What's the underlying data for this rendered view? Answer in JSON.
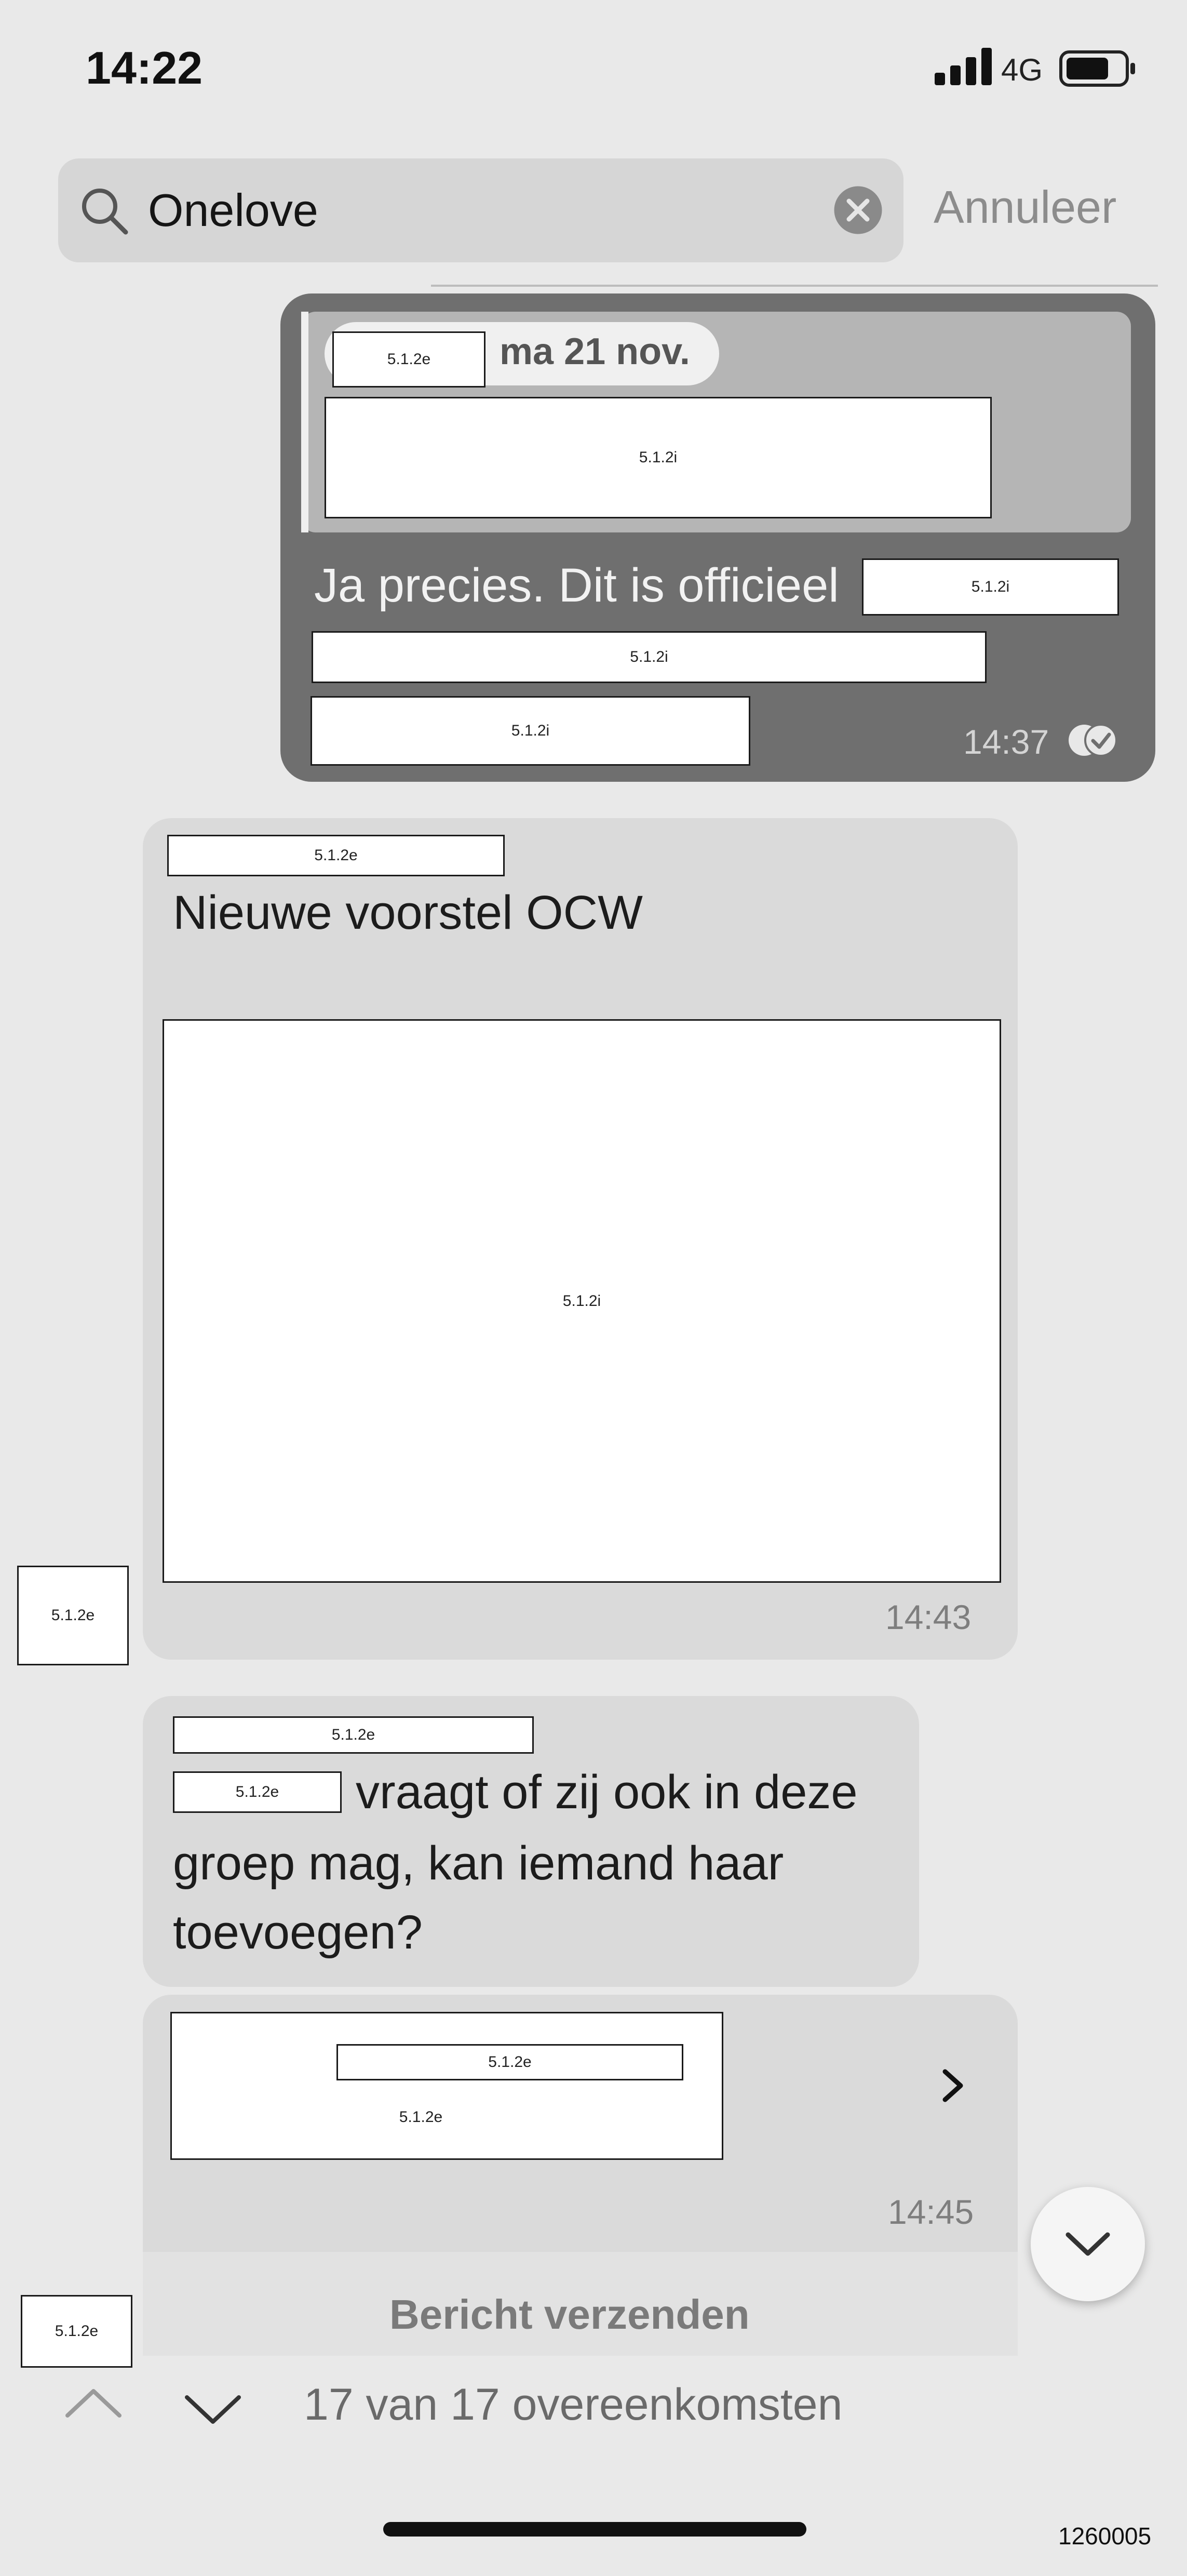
{
  "status_bar": {
    "time": "14:22",
    "network": "4G",
    "icons": [
      "signal-bars-icon",
      "battery-icon"
    ]
  },
  "search": {
    "query": "Onelove",
    "cancel_label": "Annuleer",
    "icons": [
      "search-icon",
      "clear-search-icon"
    ]
  },
  "messages": {
    "outgoing": {
      "date_pill_label": "ma 21 nov.",
      "text": "Ja precies. Dit is officieel",
      "time": "14:37",
      "status_icon": "read-receipt-icon"
    },
    "incoming_1": {
      "text": "Nieuwe voorstel OCW",
      "time": "14:43"
    },
    "incoming_2": {
      "line_1_suffix": "vraagt of zij ook in deze",
      "line_2": "groep mag, kan iemand haar",
      "line_3": "toevoegen?"
    },
    "incoming_3": {
      "time": "14:45",
      "icon": "chevron-right-icon"
    }
  },
  "redactions": {
    "sender_name": "5.1.2e",
    "content": "5.1.2i"
  },
  "send_message_label": "Bericht verzenden",
  "search_nav": {
    "match_count": "17 van 17 overeenkomsten",
    "icons": [
      "chevron-up-icon",
      "chevron-down-icon"
    ]
  },
  "document_number": "1260005",
  "colors": {
    "background": "#e9e9e9",
    "outgoing_bubble": "#6f6f6f",
    "incoming_bubble": "#dadada",
    "search_field": "#d6d6d6"
  }
}
